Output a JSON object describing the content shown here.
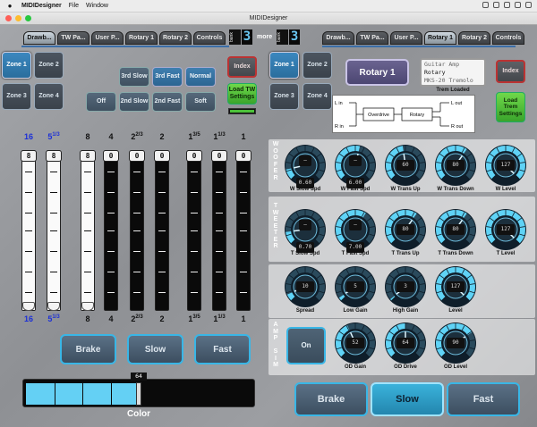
{
  "menubar": {
    "app": "MIDIDesigner",
    "file": "File",
    "window": "Window"
  },
  "window": {
    "title": "MIDIDesigner"
  },
  "tabs_left": [
    {
      "label": "Drawb...",
      "active": true
    },
    {
      "label": "TW Pa..."
    },
    {
      "label": "User P..."
    },
    {
      "label": "Rotary 1"
    },
    {
      "label": "Rotary 2"
    },
    {
      "label": "Controls"
    }
  ],
  "tabs_right": [
    {
      "label": "Drawb..."
    },
    {
      "label": "TW Pa..."
    },
    {
      "label": "User P..."
    },
    {
      "label": "Rotary 1",
      "active": true
    },
    {
      "label": "Rotary 2"
    },
    {
      "label": "Controls"
    }
  ],
  "bank_left": {
    "label": "bank",
    "value": "3"
  },
  "bank_more": "more",
  "bank_right": {
    "label": "bank",
    "value": "3"
  },
  "zones_left": [
    "Zone 1",
    "Zone 2",
    "Zone 3",
    "Zone 4"
  ],
  "zones_right": [
    "Zone 1",
    "Zone 2",
    "Zone 3",
    "Zone 4"
  ],
  "perc_buttons": {
    "row1": [
      "3rd Slow",
      "3rd Fast",
      "Normal"
    ],
    "row2": [
      "Off",
      "2nd Slow",
      "2nd Fast",
      "Soft"
    ]
  },
  "index_left": "Index",
  "load_tw": "Load TW Settings",
  "rotary_btn": "Rotary 1",
  "lcd": {
    "line1": "Guitar Amp",
    "line2": "Rotary",
    "line3": "MKS-20 Tremolo"
  },
  "trem_loaded": "Trem Loaded",
  "index_right": "Index",
  "load_trem": "Load Trem Settings",
  "diagram": {
    "lin": "L in",
    "rin": "R in",
    "overdrive": "Overdrive",
    "rotary": "Rotary",
    "lout": "L out",
    "rout": "R out"
  },
  "drawbars": [
    {
      "top": "16",
      "frac": "",
      "value": "8",
      "color": "white",
      "blue": true
    },
    {
      "top": "5",
      "frac": "1/3",
      "value": "8",
      "color": "white",
      "blue": true
    },
    {
      "top": "8",
      "frac": "",
      "value": "8",
      "color": "white",
      "blue": false
    },
    {
      "top": "4",
      "frac": "",
      "value": "0",
      "color": "black",
      "blue": false
    },
    {
      "top": "2",
      "frac": "2/3",
      "value": "0",
      "color": "black",
      "blue": false
    },
    {
      "top": "2",
      "frac": "",
      "value": "0",
      "color": "black",
      "blue": false
    },
    {
      "top": "1",
      "frac": "3/5",
      "value": "0",
      "color": "black",
      "blue": false
    },
    {
      "top": "1",
      "frac": "1/3",
      "value": "0",
      "color": "black",
      "blue": false
    },
    {
      "top": "1",
      "frac": "",
      "value": "0",
      "color": "black",
      "blue": false
    }
  ],
  "left_speed": [
    "Brake",
    "Slow",
    "Fast"
  ],
  "left_speed_active": 1,
  "color_slider": {
    "label": "Color",
    "value": "64",
    "fraction": 0.5
  },
  "sections": {
    "woofer": "WOOFER",
    "tweeter": "TWEETER",
    "ampsim": "AMP SIM"
  },
  "woofer_knobs": [
    {
      "label": "W Slow Spd",
      "value": "0.60",
      "fraction": 0.12,
      "center": "—"
    },
    {
      "label": "W Fast Spd",
      "value": "6.00",
      "fraction": 0.55,
      "center": "—"
    },
    {
      "label": "W Trans Up",
      "value": "60",
      "fraction": 0.47,
      "center": ""
    },
    {
      "label": "W Trans Down",
      "value": "80",
      "fraction": 0.63,
      "center": ""
    },
    {
      "label": "W Level",
      "value": "127",
      "fraction": 1.0,
      "center": ""
    }
  ],
  "tweeter_knobs": [
    {
      "label": "T Slow Spd",
      "value": "0.70",
      "fraction": 0.14,
      "center": "—"
    },
    {
      "label": "T Fast Spd",
      "value": "7.00",
      "fraction": 0.62,
      "center": "—"
    },
    {
      "label": "T Trans Up",
      "value": "80",
      "fraction": 0.63,
      "center": ""
    },
    {
      "label": "T Trans Down",
      "value": "80",
      "fraction": 0.63,
      "center": ""
    },
    {
      "label": "T Level",
      "value": "127",
      "fraction": 1.0,
      "center": ""
    }
  ],
  "misc_knobs": [
    {
      "label": "Spread",
      "value": "10",
      "fraction": 0.08,
      "center": ""
    },
    {
      "label": "Low Gain",
      "value": "5",
      "fraction": 0.04,
      "center": ""
    },
    {
      "label": "High Gain",
      "value": "3",
      "fraction": 0.02,
      "center": ""
    },
    {
      "label": "Level",
      "value": "127",
      "fraction": 1.0,
      "center": ""
    }
  ],
  "amp_on": "On",
  "amp_knobs": [
    {
      "label": "OD Gain",
      "value": "52",
      "fraction": 0.41,
      "center": ""
    },
    {
      "label": "OD Drive",
      "value": "64",
      "fraction": 0.5,
      "center": ""
    },
    {
      "label": "OD Level",
      "value": "90",
      "fraction": 0.71,
      "center": ""
    }
  ],
  "right_speed": [
    "Brake",
    "Slow",
    "Fast"
  ],
  "right_speed_active": 1,
  "colors": {
    "accent": "#39b6e6",
    "active_tab": "#cfd8e0",
    "green": "#4cc23a",
    "red_border": "#b33333"
  }
}
